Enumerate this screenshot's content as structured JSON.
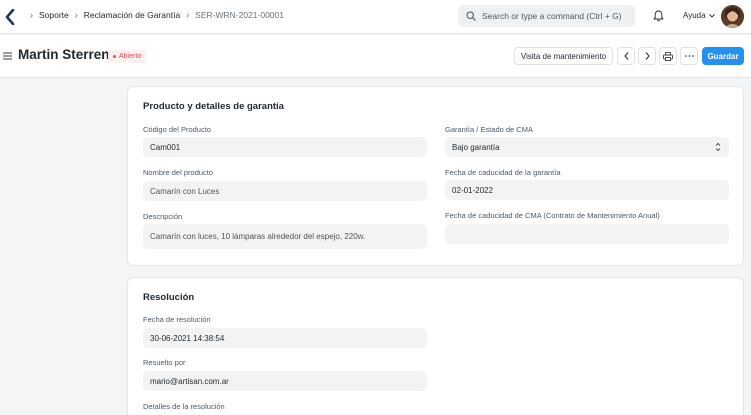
{
  "navbar": {
    "breadcrumbs": [
      "Soporte",
      "Reclamación de Garantía",
      "SER-WRN-2021-00001"
    ],
    "search_placeholder": "Search or type a command (Ctrl + G)",
    "help_label": "Ayuda"
  },
  "header": {
    "title": "Martin Sterren",
    "status": "Abierto",
    "visit_button": "Visita de mantenimiento",
    "save_button": "Guardar"
  },
  "product_section": {
    "title": "Producto y detalles de garantía",
    "item_code_label": "Código del Producto",
    "item_code_value": "Cam001",
    "item_name_label": "Nombre del producto",
    "item_name_value": "Camarín con Luces",
    "description_label": "Descripción",
    "description_value": "Camarín con luces, 10 lámparas alrededor del espejo, 220w.",
    "warranty_status_label": "Garantía / Estado de CMA",
    "warranty_status_value": "Bajo garantía",
    "warranty_expiry_label": "Fecha de caducidad de la garantía",
    "warranty_expiry_value": "02-01-2022",
    "amc_expiry_label": "Fecha de caducidad de CMA (Contrato de Mantenimiento Anual)",
    "amc_expiry_value": ""
  },
  "resolution_section": {
    "title": "Resolución",
    "resolution_date_label": "Fecha de resolución",
    "resolution_date_value": "30-06-2021 14:38:54",
    "resolved_by_label": "Resuelto por",
    "resolved_by_value": "mario@artisan.com.ar",
    "details_label": "Detalles de la resolución"
  },
  "colors": {
    "primary": "#2490ef",
    "status_red": "#e24c4c",
    "background": "#f4f5f6"
  },
  "icons": [
    "back-logo-icon",
    "chevron-right-icon",
    "search-icon",
    "bell-icon",
    "chevron-down-icon",
    "hamburger-icon",
    "chevron-left-icon",
    "printer-icon",
    "more-icon",
    "select-caret-icon"
  ]
}
